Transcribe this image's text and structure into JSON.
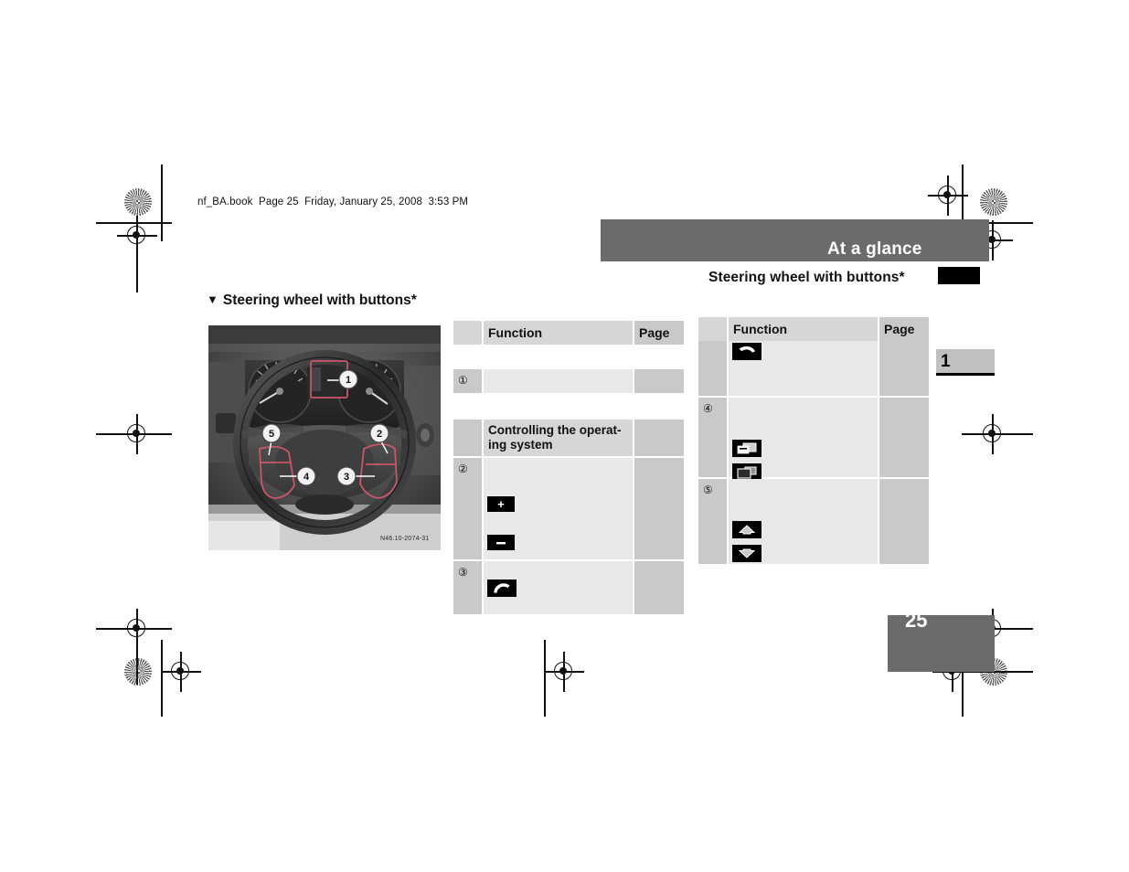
{
  "document": {
    "file_stamp": "nf_BA.book  Page 25  Friday, January 25, 2008  3:53 PM",
    "running_head": "At a glance",
    "sub_head": "Steering wheel with buttons*",
    "chapter_tab": "1",
    "folio": "25",
    "section_heading": "Steering wheel with buttons*",
    "section_heading_marker": "▼"
  },
  "figure": {
    "caption": "N46.10-2074-31",
    "callouts": [
      "1",
      "2",
      "3",
      "4",
      "5"
    ],
    "alt_name": "steering-wheel-with-buttons-photo"
  },
  "tables": {
    "left": {
      "headers": {
        "num": "",
        "function": "Function",
        "page": "Page"
      },
      "rows": [
        {
          "num": "①",
          "function": "",
          "page": "",
          "icons": []
        },
        {
          "num": "",
          "function": "Controlling the operat-\ning system",
          "page": "",
          "icons": []
        },
        {
          "num": "②",
          "function": "",
          "page": "",
          "icons": [
            "volume-up-key",
            "volume-down-key"
          ]
        },
        {
          "num": "③",
          "function": "",
          "page": "",
          "icons": [
            "accept-call-key"
          ]
        }
      ]
    },
    "right": {
      "headers": {
        "num": "",
        "function": "Function",
        "page": "Page"
      },
      "rows": [
        {
          "num": "",
          "function": "",
          "page": "",
          "icons": [
            "end-call-key"
          ]
        },
        {
          "num": "④",
          "function": "",
          "page": "",
          "icons": [
            "next-display-key",
            "previous-display-key"
          ]
        },
        {
          "num": "⑤",
          "function": "",
          "page": "",
          "icons": [
            "scroll-up-key",
            "scroll-down-key"
          ]
        }
      ]
    }
  },
  "colors": {
    "band_gray": "#6b6b6b",
    "cell_num_gray": "#c9c9c9",
    "cell_function_gray": "#e8e8e8",
    "cell_function_alt_gray": "#d6d6d6",
    "key_black": "#000000",
    "callout_red": "#c9566a"
  }
}
